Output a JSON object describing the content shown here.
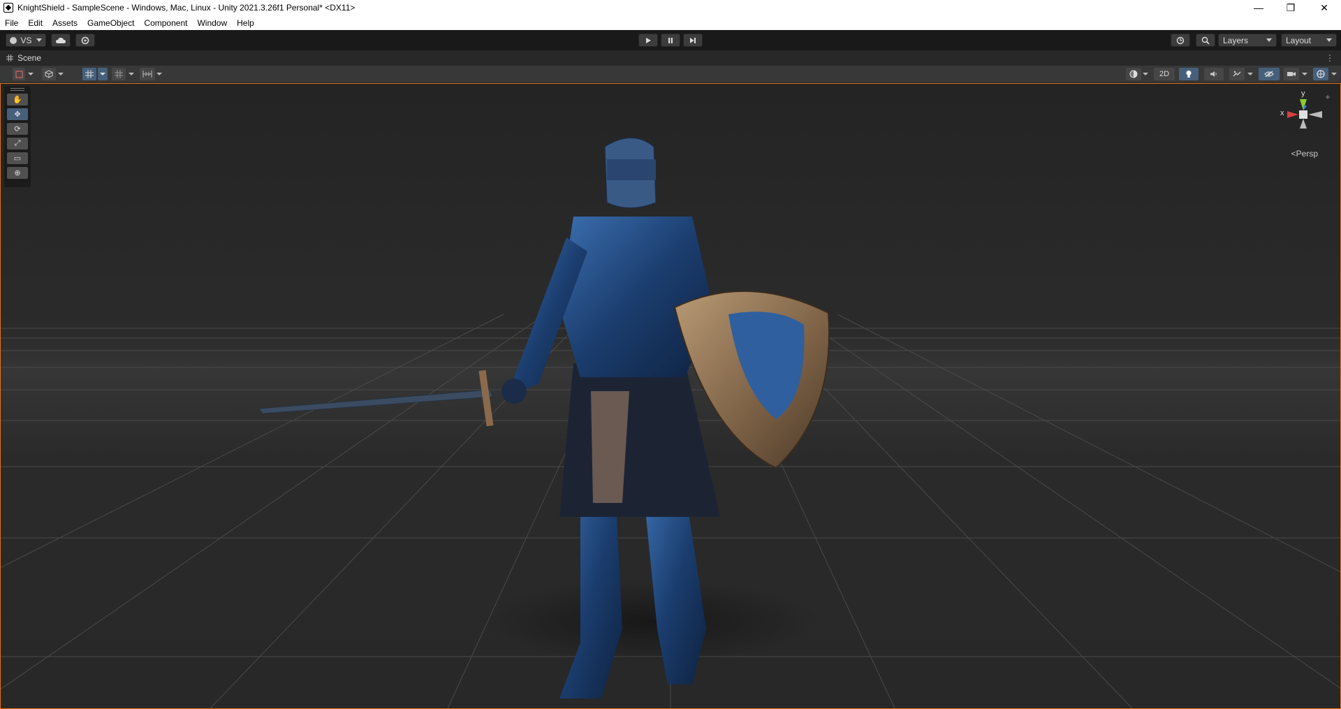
{
  "window": {
    "title": "KnightShield - SampleScene - Windows, Mac, Linux - Unity 2021.3.26f1 Personal* <DX11>",
    "controls": [
      "—",
      "❐",
      "✕"
    ]
  },
  "menu": [
    "File",
    "Edit",
    "Assets",
    "GameObject",
    "Component",
    "Window",
    "Help"
  ],
  "toolbar": {
    "account_label": "VS",
    "cloud_icon": "cloud-icon",
    "services_icon": "services-gear-icon",
    "play_icon": "play-icon",
    "pause_icon": "pause-icon",
    "step_icon": "step-icon",
    "history_icon": "undo-history-icon",
    "search_icon": "search-icon",
    "layers_label": "Layers",
    "layout_label": "Layout"
  },
  "scene_tab": {
    "label": "Scene"
  },
  "scene_toolbar": {
    "draw_mode_icon": "draw-mode-icon",
    "render_icon": "cube-icon",
    "grid_snap_icon": "grid-snap-icon",
    "grid_icon": "grid-icon",
    "increment_icon": "increment-snap-icon",
    "shading_icon": "shading-sphere-icon",
    "mode_2d_label": "2D",
    "lighting_icon": "light-bulb-icon",
    "audio_icon": "audio-icon",
    "effects_icon": "effects-icon",
    "visibility_icon": "hidden-eye-icon",
    "camera_icon": "camera-icon",
    "gizmos_icon": "gizmos-globe-icon"
  },
  "tools": [
    {
      "name": "hand-tool",
      "glyph": "✋",
      "active": false
    },
    {
      "name": "move-tool",
      "glyph": "✥",
      "active": true
    },
    {
      "name": "rotate-tool",
      "glyph": "⟳",
      "active": false
    },
    {
      "name": "scale-tool",
      "glyph": "⤢",
      "active": false
    },
    {
      "name": "rect-tool",
      "glyph": "▭",
      "active": false
    },
    {
      "name": "transform-tool",
      "glyph": "⊕",
      "active": false
    }
  ],
  "gizmo": {
    "y_label": "y",
    "x_label": "x",
    "projection_label": "Persp",
    "projection_glyph": "<"
  },
  "colors": {
    "accent_orange": "#e2731c",
    "active_blue": "#46607c",
    "axis_x": "#d9413b",
    "axis_y": "#8ccc2a",
    "axis_z": "#3d7ee0"
  }
}
